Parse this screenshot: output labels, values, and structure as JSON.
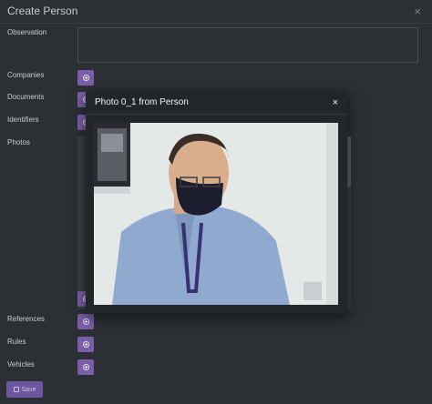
{
  "form": {
    "title": "Create Person",
    "close_label": "×",
    "labels": {
      "observation": "Observation",
      "companies": "Companies",
      "documents": "Documents",
      "identifiers": "Identifiers",
      "photos": "Photos",
      "references": "References",
      "rules": "Rules",
      "vehicles": "Vehicles"
    },
    "save_label": "Save",
    "observation_value": ""
  },
  "photo_modal": {
    "title": "Photo 0_1 from Person",
    "close_label": "×"
  },
  "icons": {
    "add": "plus-circle-icon",
    "save": "floppy-disk-icon",
    "close": "close-icon"
  },
  "colors": {
    "accent": "#7a5fa8",
    "background": "#2c3035",
    "modal": "#22262b"
  }
}
